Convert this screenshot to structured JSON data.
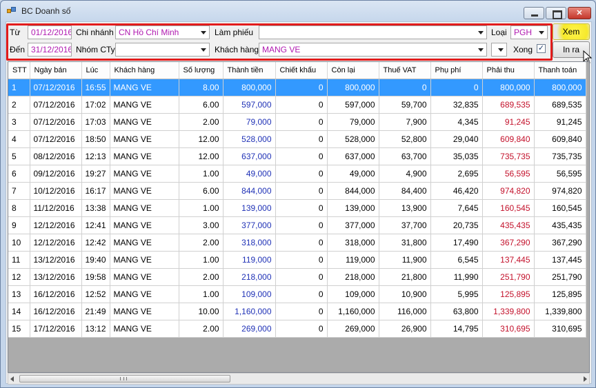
{
  "window": {
    "title": "BC Doanh số",
    "minimize_label": "",
    "maximize_label": "",
    "close_label": "✕"
  },
  "filters": {
    "from_label": "Từ",
    "from_value": "01/12/2016",
    "to_label": "Đến",
    "to_value": "31/12/2016",
    "branch_label": "Chi nhánh",
    "branch_value": "CN Hồ Chí Minh",
    "company_group_label": "Nhóm CTy",
    "company_group_value": "",
    "creator_label": "Làm phiếu",
    "creator_value": "",
    "customer_label": "Khách hàng",
    "customer_value": "MANG VE",
    "customer_extra_value": "",
    "type_label": "Loại",
    "type_value": "PGH",
    "done_label": "Xong",
    "done_checked": "✓",
    "view_button": "Xem",
    "print_button": "In ra"
  },
  "table": {
    "columns": [
      "STT",
      "Ngày bán",
      "Lúc",
      "Khách hàng",
      "Số lượng",
      "Thành tiền",
      "Chiết khấu",
      "Còn lại",
      "Thuế VAT",
      "Phụ phí",
      "Phải thu",
      "Thanh toán"
    ],
    "rows": [
      [
        "1",
        "07/12/2016",
        "16:55",
        "MANG VE",
        "8.00",
        "800,000",
        "0",
        "800,000",
        "0",
        "0",
        "800,000",
        "800,000"
      ],
      [
        "2",
        "07/12/2016",
        "17:02",
        "MANG VE",
        "6.00",
        "597,000",
        "0",
        "597,000",
        "59,700",
        "32,835",
        "689,535",
        "689,535"
      ],
      [
        "3",
        "07/12/2016",
        "17:03",
        "MANG VE",
        "2.00",
        "79,000",
        "0",
        "79,000",
        "7,900",
        "4,345",
        "91,245",
        "91,245"
      ],
      [
        "4",
        "07/12/2016",
        "18:50",
        "MANG VE",
        "12.00",
        "528,000",
        "0",
        "528,000",
        "52,800",
        "29,040",
        "609,840",
        "609,840"
      ],
      [
        "5",
        "08/12/2016",
        "12:13",
        "MANG VE",
        "12.00",
        "637,000",
        "0",
        "637,000",
        "63,700",
        "35,035",
        "735,735",
        "735,735"
      ],
      [
        "6",
        "09/12/2016",
        "19:27",
        "MANG VE",
        "1.00",
        "49,000",
        "0",
        "49,000",
        "4,900",
        "2,695",
        "56,595",
        "56,595"
      ],
      [
        "7",
        "10/12/2016",
        "16:17",
        "MANG VE",
        "6.00",
        "844,000",
        "0",
        "844,000",
        "84,400",
        "46,420",
        "974,820",
        "974,820"
      ],
      [
        "8",
        "11/12/2016",
        "13:38",
        "MANG VE",
        "1.00",
        "139,000",
        "0",
        "139,000",
        "13,900",
        "7,645",
        "160,545",
        "160,545"
      ],
      [
        "9",
        "12/12/2016",
        "12:41",
        "MANG VE",
        "3.00",
        "377,000",
        "0",
        "377,000",
        "37,700",
        "20,735",
        "435,435",
        "435,435"
      ],
      [
        "10",
        "12/12/2016",
        "12:42",
        "MANG VE",
        "2.00",
        "318,000",
        "0",
        "318,000",
        "31,800",
        "17,490",
        "367,290",
        "367,290"
      ],
      [
        "11",
        "13/12/2016",
        "19:40",
        "MANG VE",
        "1.00",
        "119,000",
        "0",
        "119,000",
        "11,900",
        "6,545",
        "137,445",
        "137,445"
      ],
      [
        "12",
        "13/12/2016",
        "19:58",
        "MANG VE",
        "2.00",
        "218,000",
        "0",
        "218,000",
        "21,800",
        "11,990",
        "251,790",
        "251,790"
      ],
      [
        "13",
        "16/12/2016",
        "12:52",
        "MANG VE",
        "1.00",
        "109,000",
        "0",
        "109,000",
        "10,900",
        "5,995",
        "125,895",
        "125,895"
      ],
      [
        "14",
        "16/12/2016",
        "21:49",
        "MANG VE",
        "10.00",
        "1,160,000",
        "0",
        "1,160,000",
        "116,000",
        "63,800",
        "1,339,800",
        "1,339,800"
      ],
      [
        "15",
        "17/12/2016",
        "13:12",
        "MANG VE",
        "2.00",
        "269,000",
        "0",
        "269,000",
        "26,900",
        "14,795",
        "310,695",
        "310,695"
      ]
    ]
  },
  "colors": {
    "selection": "#3399ff",
    "amount_blue": "#1f31b6",
    "receivable_red": "#c3102a",
    "filter_value_magenta": "#b019b0",
    "highlight_box_red": "#e21b1b"
  },
  "icons": [
    "app-icon",
    "minimize-icon",
    "maximize-icon",
    "close-icon",
    "dropdown-arrow-icon",
    "checkbox-icon",
    "mouse-cursor-icon",
    "scroll-left-icon",
    "scroll-right-icon"
  ]
}
